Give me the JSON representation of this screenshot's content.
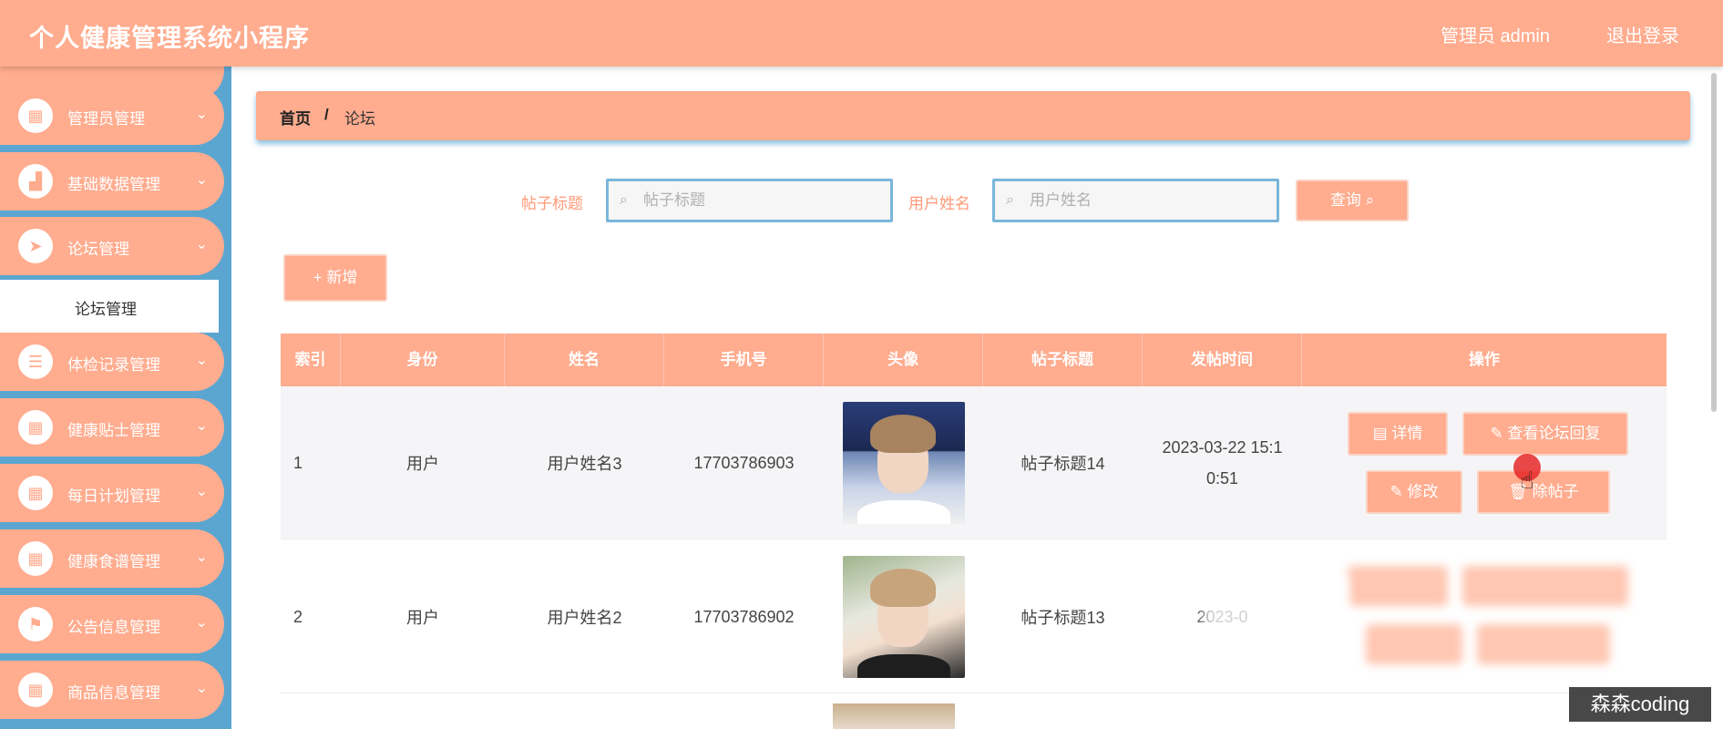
{
  "app": {
    "title": "个人健康管理系统小程序",
    "admin_label": "管理员 admin",
    "logout": "退出登录"
  },
  "sidebar": {
    "items": [
      {
        "label": "管理员管理",
        "icon": "grid-icon"
      },
      {
        "label": "基础数据管理",
        "icon": "chart-icon"
      },
      {
        "label": "论坛管理",
        "icon": "send-icon"
      },
      {
        "label": "体检记录管理",
        "icon": "sliders-icon"
      },
      {
        "label": "健康贴士管理",
        "icon": "grid-icon"
      },
      {
        "label": "每日计划管理",
        "icon": "grid-icon"
      },
      {
        "label": "健康食谱管理",
        "icon": "grid-icon"
      },
      {
        "label": "公告信息管理",
        "icon": "flag-icon"
      },
      {
        "label": "商品信息管理",
        "icon": "grid-icon"
      }
    ],
    "sub_item": "论坛管理"
  },
  "breadcrumb": {
    "home": "首页",
    "separator": "/",
    "current": "论坛"
  },
  "search": {
    "title_label": "帖子标题",
    "title_placeholder": "帖子标题",
    "user_label": "用户姓名",
    "user_placeholder": "用户姓名",
    "query_button": "查询"
  },
  "add_button": "+ 新增",
  "table": {
    "headers": [
      "索引",
      "身份",
      "姓名",
      "手机号",
      "头像",
      "帖子标题",
      "发帖时间",
      "操作"
    ],
    "rows": [
      {
        "index": "1",
        "role": "用户",
        "name": "用户姓名3",
        "phone": "17703786903",
        "title": "帖子标题14",
        "time_line1": "2023-03-22 15:1",
        "time_line2": "0:51"
      },
      {
        "index": "2",
        "role": "用户",
        "name": "用户姓名2",
        "phone": "17703786902",
        "title": "帖子标题13",
        "time_line1": "2023-0",
        "time_line2": ""
      }
    ],
    "actions": {
      "detail": "详情",
      "view_replies": "查看论坛回复",
      "edit": "修改",
      "delete_partial": "除帖子"
    }
  },
  "watermark": "森森coding",
  "colors": {
    "accent": "#ffac8f",
    "sidebar": "#5ba6d1",
    "label": "#ff9a78",
    "input_border": "#7ab6da"
  }
}
